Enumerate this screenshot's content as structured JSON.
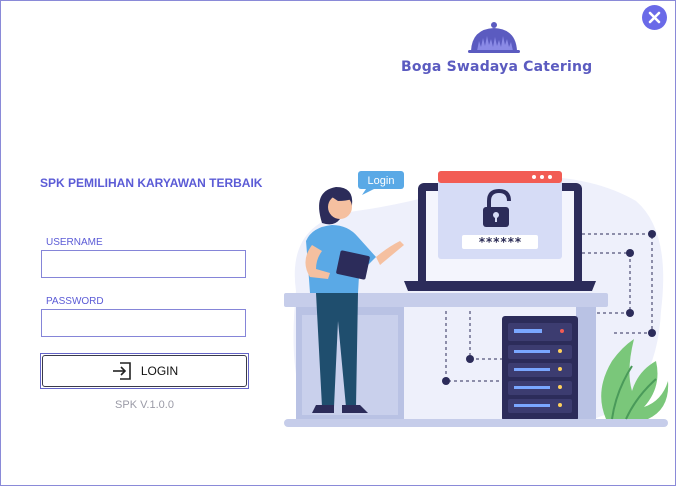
{
  "window": {
    "close_icon": "close-icon",
    "accent_color": "#6a6ae8"
  },
  "brand": {
    "name": "Boga Swadaya Catering",
    "logo_icon": "cloche-icon"
  },
  "app_title": "SPK PEMILIHAN KARYAWAN TERBAIK",
  "form": {
    "username_label": "USERNAME",
    "username_value": "",
    "password_label": "PASSWORD",
    "password_value": "",
    "login_label": "LOGIN",
    "login_icon": "login-icon"
  },
  "version": "SPK V.1.0.0",
  "illustration": {
    "speech_bubble": "Login",
    "password_mask": "******",
    "icons": [
      "padlock-icon",
      "laptop-icon",
      "server-icon",
      "person-icon",
      "plant-icon"
    ]
  }
}
